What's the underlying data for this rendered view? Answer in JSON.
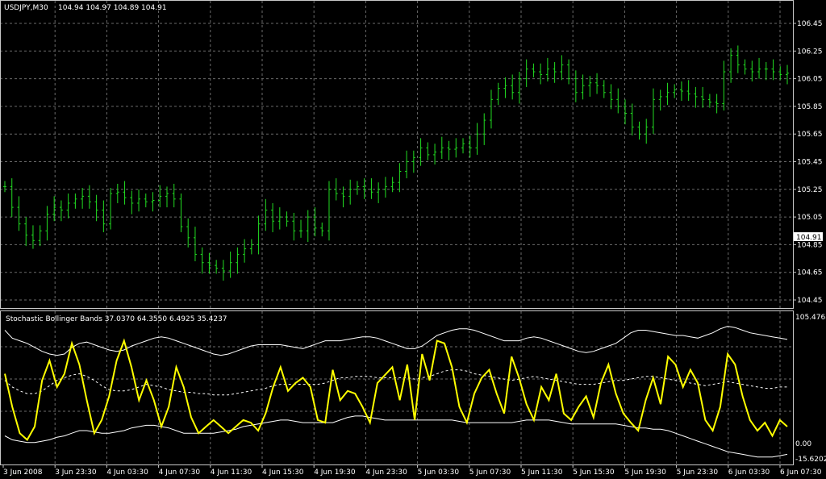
{
  "main_chart": {
    "symbol_label": "USDJPY,M30",
    "ohlc_label": "104.94 104.97 104.89 104.91",
    "bid_label": "104.91",
    "price_ticks": [
      "106.45",
      "106.25",
      "106.05",
      "105.85",
      "105.65",
      "105.45",
      "105.25",
      "105.05",
      "104.85",
      "104.65",
      "104.45"
    ]
  },
  "indicator": {
    "label": "Stochastic Bollinger Bands 37.0370 64.3550 6.4925 35.4237",
    "top_label": "105.4768",
    "zero_label": "0.00",
    "bottom_label": "-15.6202"
  },
  "time_axis": [
    "3 Jun 2008",
    "3 Jun 23:30",
    "4 Jun 03:30",
    "4 Jun 07:30",
    "4 Jun 11:30",
    "4 Jun 15:30",
    "4 Jun 19:30",
    "4 Jun 23:30",
    "5 Jun 03:30",
    "5 Jun 07:30",
    "5 Jun 11:30",
    "5 Jun 15:30",
    "5 Jun 19:30",
    "5 Jun 23:30",
    "6 Jun 03:30",
    "6 Jun 07:30"
  ],
  "colors": {
    "background": "#000000",
    "bars": "#22dd22",
    "stochastic": "#ffff00",
    "bands": "#ffffff",
    "grid": "#6b6b6b"
  },
  "chart_data": [
    {
      "type": "ohlc",
      "title": "USDJPY,M30",
      "price_range": [
        104.4,
        106.55
      ],
      "closes": [
        105.27,
        105.12,
        105.0,
        104.92,
        104.88,
        104.95,
        105.07,
        105.12,
        105.1,
        105.15,
        105.18,
        105.2,
        105.16,
        105.1,
        105.0,
        105.22,
        105.23,
        105.19,
        105.15,
        105.18,
        105.16,
        105.17,
        105.2,
        105.22,
        105.18,
        104.98,
        104.9,
        104.78,
        104.72,
        104.7,
        104.68,
        104.66,
        104.72,
        104.78,
        104.82,
        104.85,
        105.0,
        105.1,
        105.02,
        105.05,
        105.02,
        104.95,
        104.95,
        105.05,
        104.97,
        104.95,
        105.25,
        105.22,
        105.2,
        105.25,
        105.27,
        105.25,
        105.23,
        105.25,
        105.27,
        105.3,
        105.38,
        105.45,
        105.48,
        105.55,
        105.5,
        105.52,
        105.55,
        105.54,
        105.55,
        105.58,
        105.55,
        105.65,
        105.75,
        105.9,
        105.98,
        106.0,
        105.95,
        106.05,
        106.12,
        106.1,
        106.08,
        106.12,
        106.1,
        106.15,
        106.05,
        105.95,
        106.0,
        106.02,
        106.0,
        105.95,
        105.9,
        105.85,
        105.8,
        105.7,
        105.65,
        105.7,
        105.9,
        105.92,
        105.95,
        105.97,
        105.96,
        105.94,
        105.92,
        105.9,
        105.88,
        105.87,
        106.1,
        106.22,
        106.15,
        106.12,
        106.1,
        106.12,
        106.12,
        106.1,
        106.08,
        106.09
      ]
    },
    {
      "type": "line",
      "title": "Stochastic Bollinger Bands",
      "y_range": [
        -15.6202,
        105.4768
      ],
      "series": [
        {
          "name": "",
          "values": [
            65,
            40,
            20,
            15,
            25,
            60,
            75,
            55,
            65,
            88,
            72,
            45,
            20,
            30,
            48,
            75,
            90,
            70,
            45,
            60,
            45,
            25,
            40,
            70,
            55,
            32,
            20,
            25,
            30,
            25,
            20,
            25,
            30,
            28,
            22,
            35,
            55,
            70,
            52,
            58,
            62,
            55,
            30,
            28,
            68,
            45,
            52,
            50,
            40,
            28,
            58,
            64,
            70,
            45,
            72,
            30,
            80,
            60,
            90,
            88,
            70,
            40,
            28,
            50,
            62,
            68,
            50,
            35,
            78,
            62,
            42,
            30,
            55,
            45,
            65,
            35,
            30,
            40,
            48,
            32,
            58,
            72,
            50,
            35,
            28,
            22,
            45,
            62,
            42,
            78,
            72,
            55,
            68,
            58,
            30,
            22,
            40,
            80,
            72,
            48,
            30,
            22,
            28,
            18,
            30,
            25
          ]
        },
        {
          "name": "",
          "values": [
            98,
            92,
            90,
            88,
            85,
            82,
            80,
            79,
            80,
            85,
            88,
            89,
            87,
            85,
            83,
            82,
            83,
            86,
            88,
            90,
            92,
            93,
            92,
            90,
            88,
            86,
            84,
            82,
            80,
            79,
            80,
            82,
            84,
            86,
            87,
            87,
            87,
            87,
            86,
            85,
            84,
            86,
            88,
            90,
            90,
            90,
            91,
            92,
            93,
            93,
            92,
            90,
            88,
            86,
            84,
            84,
            86,
            90,
            94,
            96,
            98,
            99,
            99,
            98,
            96,
            94,
            92,
            90,
            90,
            90,
            92,
            93,
            92,
            90,
            88,
            86,
            84,
            82,
            81,
            82,
            84,
            86,
            88,
            92,
            96,
            98,
            98,
            97,
            96,
            95,
            94,
            94,
            93,
            92,
            94,
            96,
            99,
            101,
            100,
            98,
            96,
            95,
            94,
            93,
            92,
            91
          ]
        },
        {
          "name": "",
          "values": [
            60,
            55,
            52,
            50,
            50,
            52,
            56,
            60,
            62,
            64,
            65,
            63,
            60,
            56,
            53,
            52,
            52,
            53,
            55,
            57,
            56,
            55,
            53,
            52,
            51,
            51,
            50,
            50,
            49,
            49,
            49,
            50,
            51,
            52,
            53,
            54,
            56,
            57,
            57,
            57,
            57,
            57,
            57,
            58,
            60,
            62,
            62,
            63,
            63,
            63,
            62,
            62,
            62,
            62,
            62,
            61,
            62,
            63,
            65,
            67,
            68,
            68,
            67,
            65,
            64,
            63,
            62,
            61,
            60,
            61,
            62,
            63,
            62,
            61,
            60,
            59,
            58,
            57,
            57,
            57,
            58,
            59,
            60,
            60,
            61,
            62,
            63,
            63,
            62,
            61,
            60,
            59,
            58,
            57,
            56,
            57,
            58,
            59,
            58,
            57,
            56,
            55,
            54,
            54,
            55,
            55
          ]
        },
        {
          "name": "",
          "values": [
            18,
            15,
            14,
            13,
            13,
            14,
            15,
            17,
            18,
            20,
            22,
            22,
            21,
            20,
            20,
            21,
            22,
            24,
            25,
            26,
            26,
            25,
            24,
            22,
            20,
            20,
            20,
            20,
            20,
            21,
            22,
            23,
            25,
            26,
            27,
            28,
            29,
            30,
            30,
            29,
            28,
            28,
            28,
            28,
            28,
            30,
            32,
            33,
            33,
            32,
            31,
            30,
            30,
            30,
            30,
            30,
            30,
            30,
            30,
            30,
            30,
            29,
            28,
            28,
            28,
            28,
            28,
            28,
            28,
            29,
            30,
            30,
            30,
            30,
            29,
            28,
            27,
            27,
            27,
            27,
            27,
            27,
            27,
            26,
            25,
            24,
            24,
            23,
            23,
            22,
            20,
            18,
            16,
            14,
            12,
            10,
            8,
            6,
            5,
            4,
            3,
            2,
            2,
            2,
            3,
            4
          ]
        }
      ]
    }
  ]
}
